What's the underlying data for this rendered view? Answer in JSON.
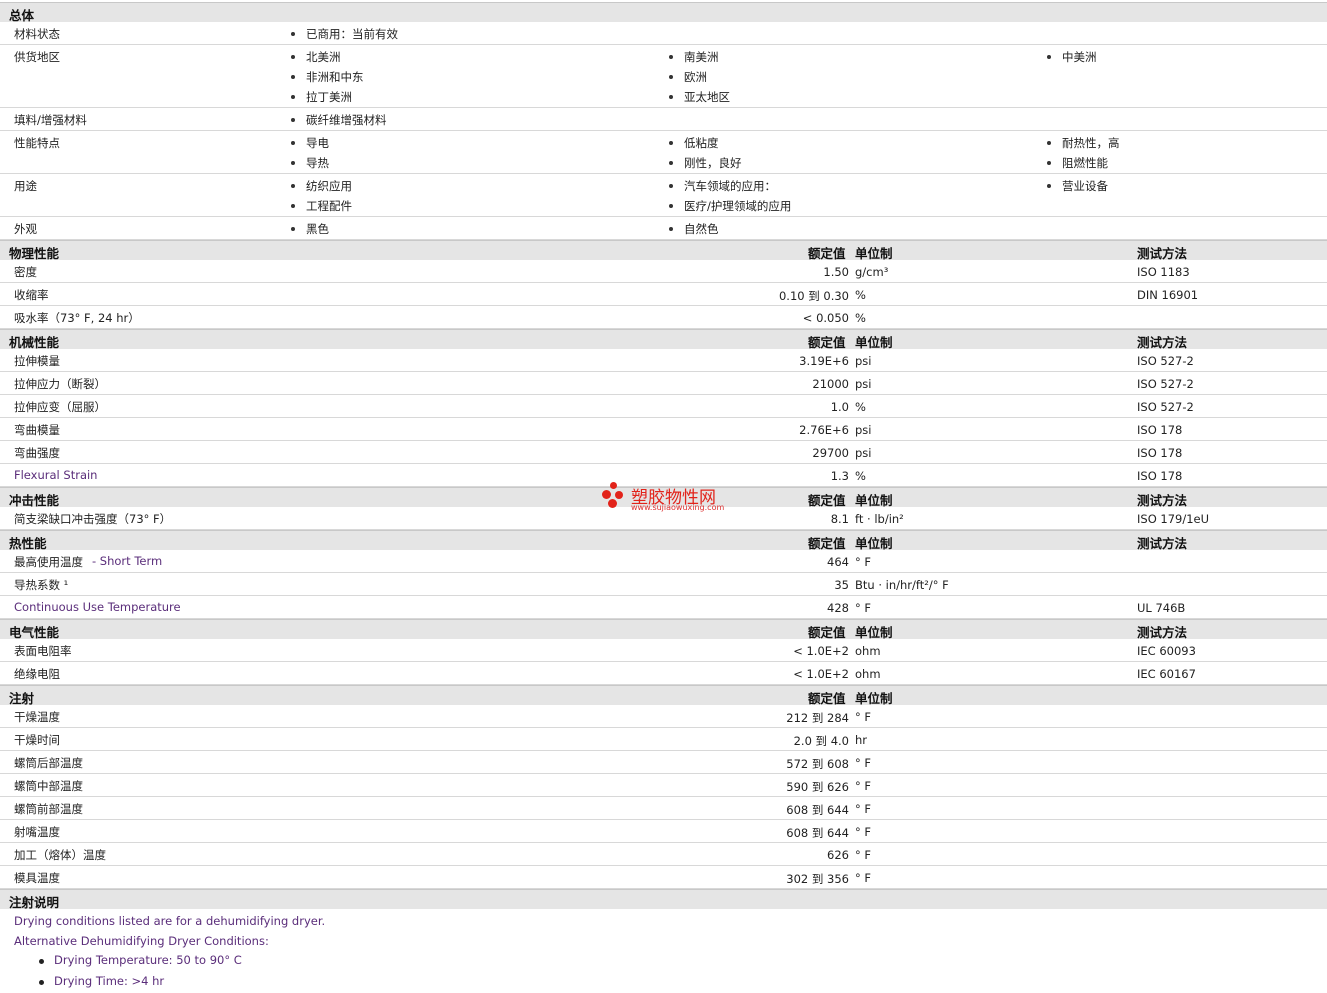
{
  "general": {
    "title": "总体",
    "rows": [
      {
        "label": "材料状态",
        "cols": [
          [
            "已商用：当前有效"
          ],
          [],
          []
        ]
      },
      {
        "label": "供货地区",
        "cols": [
          [
            "北美洲",
            "非洲和中东",
            "拉丁美洲"
          ],
          [
            "南美洲",
            "欧洲",
            "亚太地区"
          ],
          [
            "中美洲"
          ]
        ]
      },
      {
        "label": "填料/增强材料",
        "cols": [
          [
            "碳纤维增强材料"
          ],
          [],
          []
        ]
      },
      {
        "label": "性能特点",
        "cols": [
          [
            "导电",
            "导热"
          ],
          [
            "低粘度",
            "刚性，良好"
          ],
          [
            "耐热性，高",
            "阻燃性能"
          ]
        ]
      },
      {
        "label": "用途",
        "cols": [
          [
            "纺织应用",
            "工程配件"
          ],
          [
            "汽车领域的应用：",
            "医疗/护理领域的应用"
          ],
          [
            "营业设备"
          ]
        ]
      },
      {
        "label": "外观",
        "cols": [
          [
            "黑色"
          ],
          [
            "自然色"
          ],
          []
        ]
      }
    ]
  },
  "headers": {
    "value": "额定值",
    "unit": "单位制",
    "test": "测试方法"
  },
  "sections": [
    {
      "title": "物理性能",
      "show_test": true,
      "rows": [
        {
          "label": "密度",
          "value": "1.50",
          "unit": "g/cm³",
          "test": "ISO 1183"
        },
        {
          "label": "收缩率",
          "value": "0.10 到  0.30",
          "unit": "%",
          "test": "DIN 16901"
        },
        {
          "label": "吸水率（73° F, 24 hr）",
          "value": "< 0.050",
          "unit": "%",
          "test": ""
        }
      ]
    },
    {
      "title": "机械性能",
      "show_test": true,
      "rows": [
        {
          "label": "拉伸模量",
          "value": "3.19E+6",
          "unit": "psi",
          "test": "ISO 527-2"
        },
        {
          "label": "拉伸应力（断裂）",
          "value": "21000",
          "unit": "psi",
          "test": "ISO 527-2"
        },
        {
          "label": "拉伸应变（屈服）",
          "value": "1.0",
          "unit": "%",
          "test": "ISO 527-2"
        },
        {
          "label": "弯曲模量",
          "value": "2.76E+6",
          "unit": "psi",
          "test": "ISO 178"
        },
        {
          "label": "弯曲强度",
          "value": "29700",
          "unit": "psi",
          "test": "ISO 178"
        },
        {
          "label": "Flexural Strain",
          "value": "1.3",
          "unit": "%",
          "test": "ISO 178",
          "purple": true
        }
      ]
    },
    {
      "title": "冲击性能",
      "show_test": true,
      "rows": [
        {
          "label": "简支梁缺口冲击强度（73° F）",
          "value": "8.1",
          "unit": "ft · lb/in²",
          "test": "ISO 179/1eU"
        }
      ]
    },
    {
      "title": "热性能",
      "show_test": true,
      "rows": [
        {
          "label": "最高使用温度",
          "label_extra": " - Short Term",
          "value": "464",
          "unit": "° F",
          "test": ""
        },
        {
          "label": "导热系数 ¹",
          "value": "35",
          "unit": "Btu · in/hr/ft²/° F",
          "test": ""
        },
        {
          "label": "Continuous Use Temperature",
          "value": "428",
          "unit": "° F",
          "test": "UL 746B",
          "purple": true
        }
      ]
    },
    {
      "title": "电气性能",
      "show_test": true,
      "rows": [
        {
          "label": "表面电阻率",
          "value": "< 1.0E+2",
          "unit": "ohm",
          "test": "IEC 60093"
        },
        {
          "label": "绝缘电阻",
          "value": "< 1.0E+2",
          "unit": "ohm",
          "test": "IEC 60167"
        }
      ]
    },
    {
      "title": "注射",
      "show_test": false,
      "rows": [
        {
          "label": "干燥温度",
          "value": "212 到  284",
          "unit": "° F",
          "test": ""
        },
        {
          "label": "干燥时间",
          "value": "2.0 到  4.0",
          "unit": "hr",
          "test": ""
        },
        {
          "label": "螺筒后部温度",
          "value": "572 到  608",
          "unit": "° F",
          "test": ""
        },
        {
          "label": "螺筒中部温度",
          "value": "590 到  626",
          "unit": "° F",
          "test": ""
        },
        {
          "label": "螺筒前部温度",
          "value": "608 到  644",
          "unit": "° F",
          "test": ""
        },
        {
          "label": "射嘴温度",
          "value": "608 到  644",
          "unit": "° F",
          "test": ""
        },
        {
          "label": "加工（熔体）温度",
          "value": "626",
          "unit": "° F",
          "test": ""
        },
        {
          "label": "模具温度",
          "value": "302 到  356",
          "unit": "° F",
          "test": ""
        }
      ]
    }
  ],
  "notes": {
    "title": "注射说明",
    "lines": [
      "Drying conditions listed are for a dehumidifying dryer.",
      "Alternative Dehumidifying Dryer Conditions:"
    ],
    "bullets": [
      "Drying Temperature: 50 to 90° C",
      "Drying Time: >4 hr"
    ]
  },
  "watermark": {
    "name": "塑胶物性网",
    "url": "www.sujiaowuxing.com",
    "color": "#e2231a"
  }
}
